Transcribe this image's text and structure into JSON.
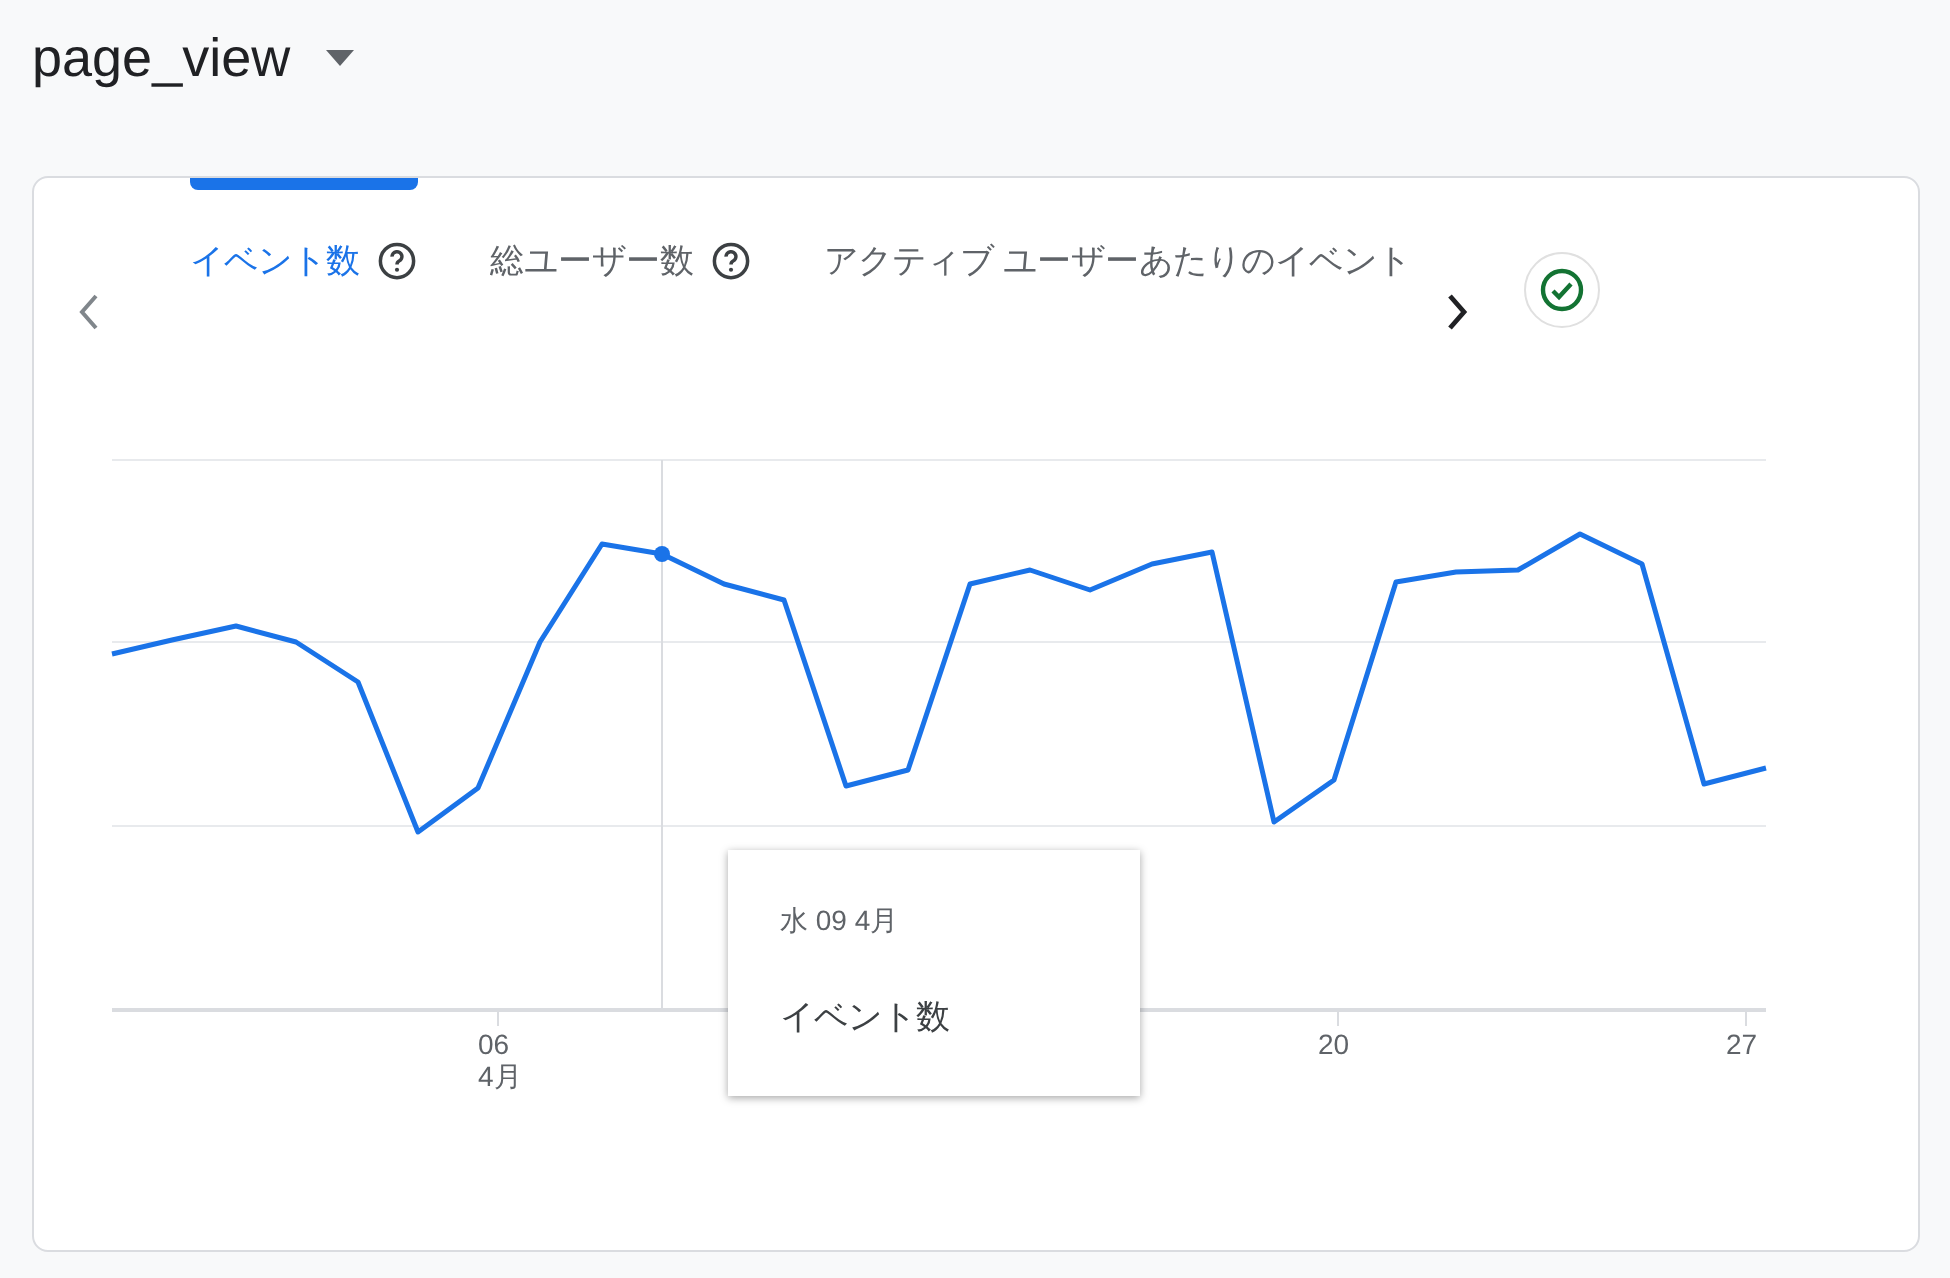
{
  "title": "page_view",
  "tabs": [
    {
      "label": "イベント数",
      "help": true,
      "selected": true
    },
    {
      "label": "総ユーザー数",
      "help": true,
      "selected": false
    },
    {
      "label": "アクティブ ユーザーあたりのイベント",
      "help": false,
      "selected": false
    }
  ],
  "chart": {
    "x_labels": [
      {
        "label": "06",
        "sub": "4月"
      },
      {
        "label": "20"
      },
      {
        "label": "27"
      }
    ],
    "tooltip": {
      "date": "水 09 4月",
      "metric": "イベント数"
    }
  }
}
